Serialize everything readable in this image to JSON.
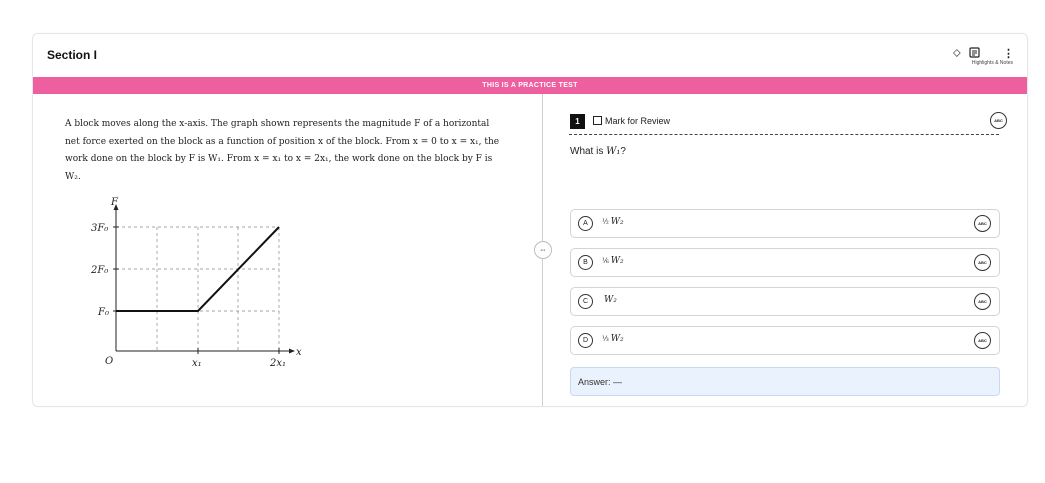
{
  "header": {
    "section_title": "Section I",
    "tools_label": "Highlights & Notes",
    "icons": [
      "highlighter-icon",
      "notes-icon",
      "more-vertical-icon"
    ]
  },
  "banner": "THIS IS A PRACTICE TEST",
  "passage": "A block moves along the x-axis. The graph shown represents the magnitude F of a horizontal net force exerted on the block as a function of position x of the block. From x = 0 to x = x₁, the work done on the block by F is W₁. From x = x₁ to x = 2x₁, the work done on the block by F is W₂.",
  "graph": {
    "y_axis_label": "F",
    "x_axis_label": "x",
    "origin_label": "O",
    "y_ticks": [
      "3F₀",
      "2F₀",
      "F₀"
    ],
    "x_ticks": [
      "x₁",
      "2x₁"
    ]
  },
  "question": {
    "number": "1",
    "mark_for_review": "Mark for Review",
    "prompt_text": "What is ",
    "prompt_var": "W₁",
    "prompt_end": "?",
    "choices": [
      {
        "letter": "A",
        "frac": "½",
        "var": "W₂"
      },
      {
        "letter": "B",
        "frac": "⅙",
        "var": "W₂"
      },
      {
        "letter": "C",
        "frac": "",
        "var": "W₂"
      },
      {
        "letter": "D",
        "frac": "⅓",
        "var": "W₂"
      }
    ],
    "answer_label": "Answer: —",
    "abc_label": "ABC"
  }
}
